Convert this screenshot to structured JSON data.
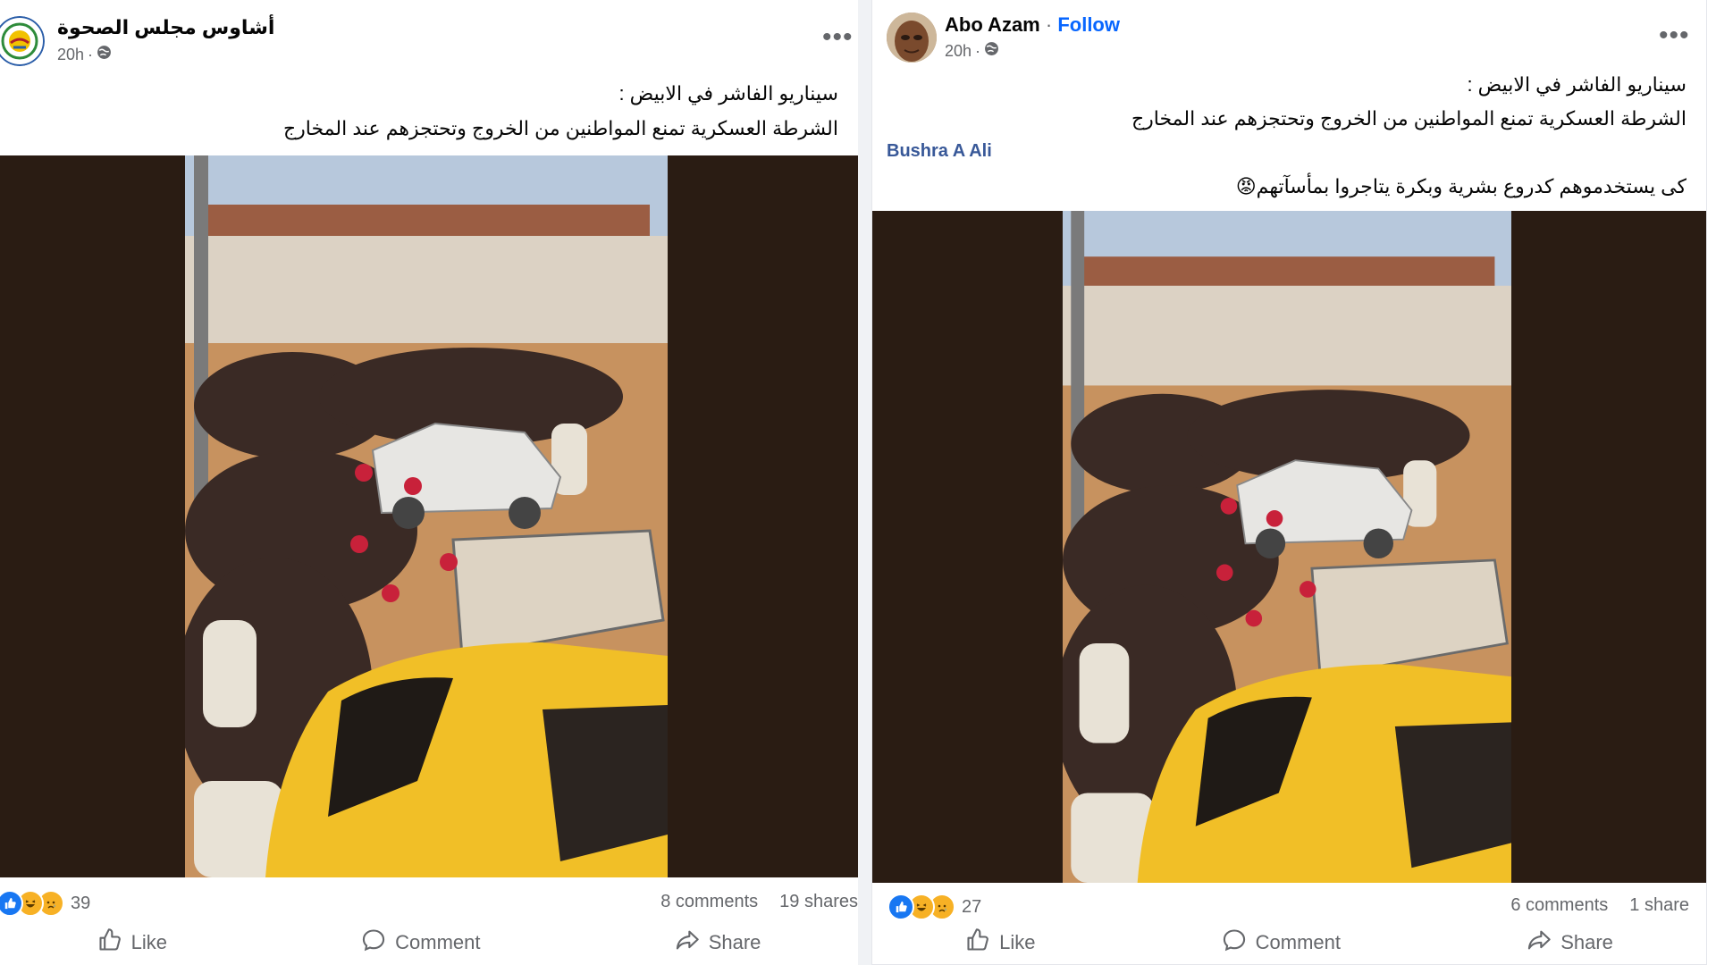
{
  "posts": [
    {
      "author": "أشاوس مجلس الصحوة",
      "time": "20h",
      "caption_lines": [
        "سيناريو الفاشر في الابيض :",
        "الشرطة العسكرية تمنع المواطنين من الخروج وتحتجزهم عند المخارج"
      ],
      "reaction_count": "39",
      "comments": "8 comments",
      "shares": "19 shares"
    },
    {
      "author": "Abo Azam",
      "follow_label": "Follow",
      "time": "20h",
      "caption_lines": [
        "سيناريو الفاشر في الابيض :",
        "الشرطة العسكرية تمنع المواطنين من الخروج وتحتجزهم عند المخارج"
      ],
      "tagged_user": "Bushra A Ali",
      "comment_line": "كى يستخدموهم كدروع بشرية وبكرة يتاجروا بمأسآتهم😡",
      "reaction_count": "27",
      "comments": "6 comments",
      "shares": "1 share"
    }
  ],
  "actions": {
    "like": "Like",
    "comment": "Comment",
    "share": "Share"
  },
  "colors": {
    "brand": "#0866ff",
    "secondary_text": "#65676b",
    "media_letterbox": "#2a1c13"
  },
  "icons": [
    "globe-icon",
    "more-icon",
    "like-reaction-icon",
    "haha-reaction-icon",
    "sad-reaction-icon",
    "like-thumb-icon",
    "comment-bubble-icon",
    "share-arrow-icon"
  ]
}
